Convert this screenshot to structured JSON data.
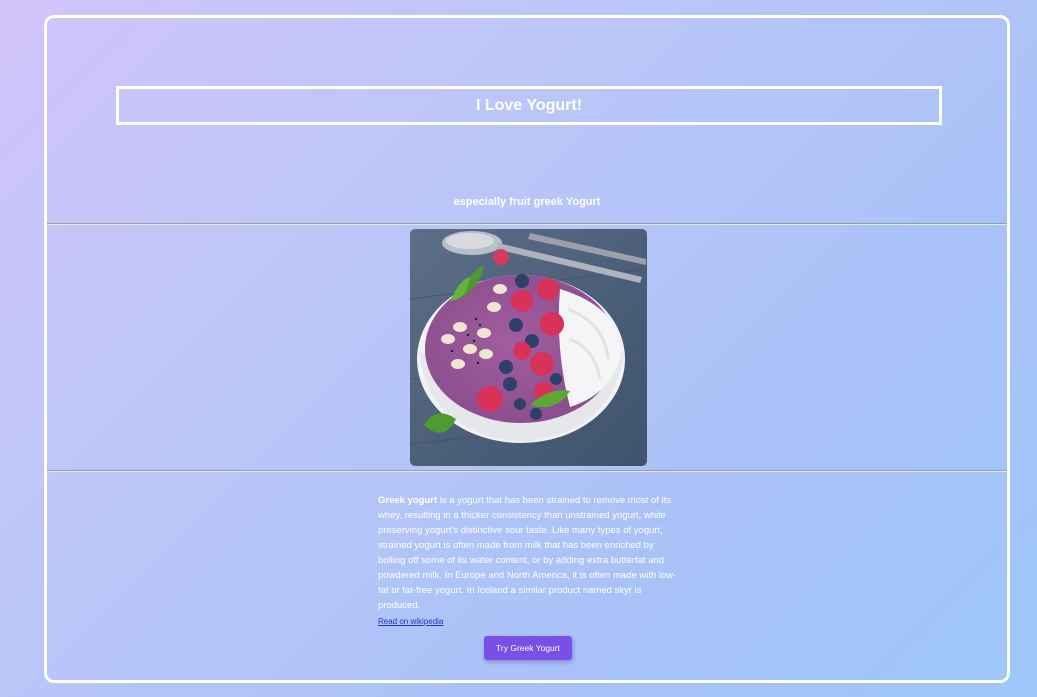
{
  "header": {
    "title": "I Love Yogurt!",
    "subtitle": "especially fruit greek Yogurt"
  },
  "image": {
    "alt": "acai yogurt bowl with raspberries, blueberries, coconut flakes, almonds and mint"
  },
  "description": {
    "bold_lead": "Greek yogurt",
    "body": " is a yogurt that has been strained to remove most of its whey, resulting in a thicker consistency than unstrained yogurt, while preserving yogurt's distinctive sour taste. Like many types of yogurt, strained yogurt is often made from milk that has been enriched by boiling off some of its water content, or by adding extra butterfat and powdered milk. In Europe and North America, it is often made with low-fat or fat-free yogurt. In Iceland a similar product named skyr is produced."
  },
  "link": {
    "label": "Read on wikipedia"
  },
  "button": {
    "label": "Try Greek Yogurt"
  },
  "colors": {
    "accent": "#7b4ee8",
    "link": "#2233bb",
    "border": "#ffffff"
  }
}
